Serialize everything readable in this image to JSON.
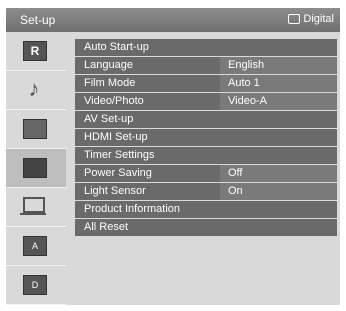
{
  "header": {
    "title": "Set-up",
    "source_label": "Digital"
  },
  "sidebar": {
    "icons": [
      {
        "name": "picture-icon",
        "label": "R"
      },
      {
        "name": "music-icon",
        "label": "♪"
      },
      {
        "name": "grid-icon",
        "label": ""
      },
      {
        "name": "setup-icon",
        "label": ""
      },
      {
        "name": "pc-icon",
        "label": ""
      },
      {
        "name": "tv-analog-icon",
        "label": "A"
      },
      {
        "name": "tv-digital-icon",
        "label": "D"
      }
    ],
    "selected_index": 3
  },
  "menu": {
    "items": [
      {
        "label": "Auto Start-up",
        "value": ""
      },
      {
        "label": "Language",
        "value": "English"
      },
      {
        "label": "Film Mode",
        "value": "Auto 1"
      },
      {
        "label": "Video/Photo",
        "value": "Video-A"
      },
      {
        "label": "AV Set-up",
        "value": ""
      },
      {
        "label": "HDMI Set-up",
        "value": ""
      },
      {
        "label": "Timer Settings",
        "value": ""
      },
      {
        "label": "Power Saving",
        "value": "Off"
      },
      {
        "label": "Light Sensor",
        "value": "On"
      },
      {
        "label": "Product Information",
        "value": ""
      },
      {
        "label": "All Reset",
        "value": ""
      }
    ]
  },
  "colors": {
    "header": "#7f7f7f",
    "panel": "#d9d9d9",
    "row": "#6a6a6a",
    "value": "#7a7a7a"
  }
}
